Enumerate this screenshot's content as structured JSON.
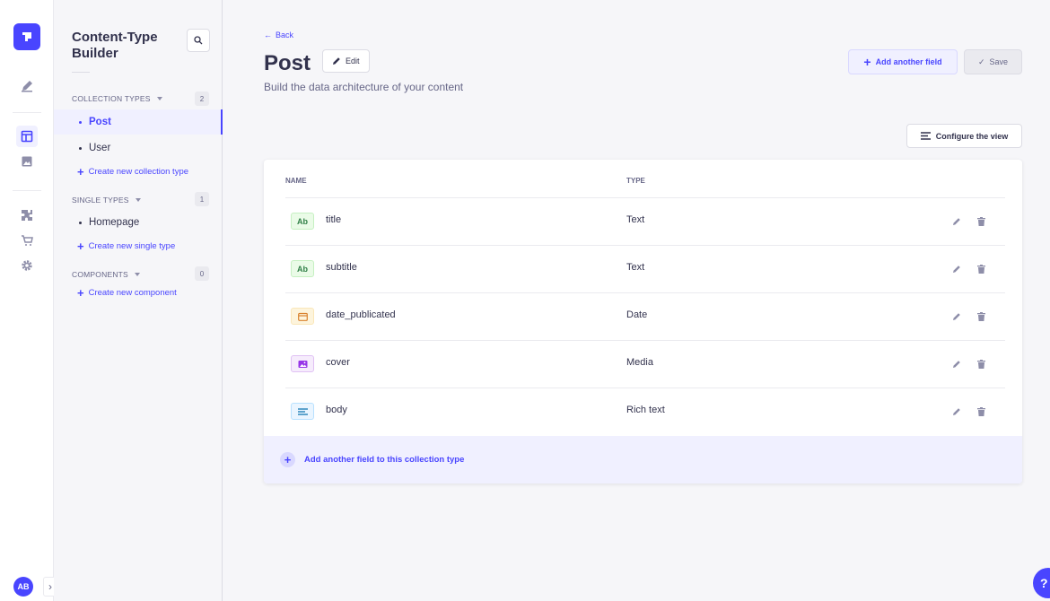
{
  "rail": {
    "avatar_initials": "AB"
  },
  "subnav": {
    "title": "Content-Type Builder",
    "collection_types": {
      "label": "COLLECTION TYPES",
      "count": "2",
      "items": [
        "Post",
        "User"
      ],
      "create": "Create new collection type"
    },
    "single_types": {
      "label": "SINGLE TYPES",
      "count": "1",
      "items": [
        "Homepage"
      ],
      "create": "Create new single type"
    },
    "components": {
      "label": "COMPONENTS",
      "count": "0",
      "create": "Create new component"
    }
  },
  "header": {
    "back": "Back",
    "title": "Post",
    "edit": "Edit",
    "subtitle": "Build the data architecture of your content",
    "add_field": "Add another field",
    "save": "Save",
    "configure": "Configure the view"
  },
  "table": {
    "columns": [
      "NAME",
      "TYPE"
    ],
    "rows": [
      {
        "icon": "Ab",
        "icon_kind": "text",
        "name": "title",
        "type": "Text"
      },
      {
        "icon": "Ab",
        "icon_kind": "text",
        "name": "subtitle",
        "type": "Text"
      },
      {
        "icon": "calendar-icon",
        "icon_kind": "date",
        "name": "date_publicated",
        "type": "Date"
      },
      {
        "icon": "image-icon",
        "icon_kind": "media",
        "name": "cover",
        "type": "Media"
      },
      {
        "icon": "paragraph-icon",
        "icon_kind": "richtext",
        "name": "body",
        "type": "Rich text"
      }
    ],
    "add_footer": "Add another field to this collection type"
  },
  "colors": {
    "primary": "#4945ff",
    "text_green": "#328048",
    "date_orange": "#d9822f",
    "media_purple": "#9736e8",
    "rich_blue": "#0c75af"
  }
}
